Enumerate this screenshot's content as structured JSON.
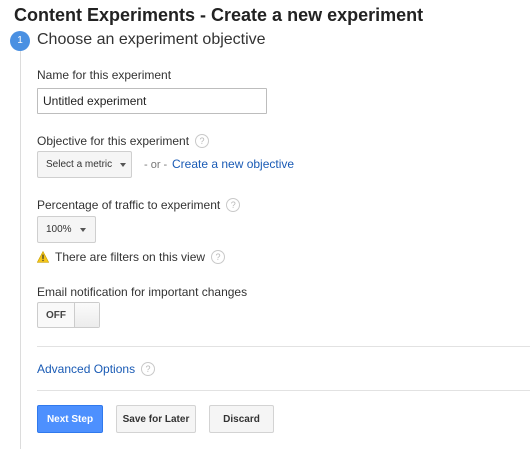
{
  "header": {
    "title": "Content Experiments - Create a new experiment"
  },
  "step": {
    "number": "1",
    "title": "Choose an experiment objective"
  },
  "name_field": {
    "label": "Name for this experiment",
    "value": "Untitled experiment"
  },
  "objective": {
    "label": "Objective for this experiment",
    "select_label": "Select a metric",
    "or_text": "- or -",
    "create_link": "Create a new objective"
  },
  "traffic": {
    "label": "Percentage of traffic to experiment",
    "selected": "100%"
  },
  "filters_warning": {
    "text": "There are filters on this view"
  },
  "email": {
    "label": "Email notification for important changes",
    "toggle_state": "OFF"
  },
  "advanced": {
    "link": "Advanced Options"
  },
  "help_glyph": "?",
  "buttons": {
    "next": "Next Step",
    "save": "Save for Later",
    "discard": "Discard"
  },
  "colors": {
    "accent": "#4a90e2",
    "link": "#1a5bb5",
    "primary_button": "#4d90fe",
    "warning": "#f5c518"
  },
  "icons": {
    "help": "question-circle-icon",
    "warning": "warning-triangle-icon",
    "caret": "caret-down-icon"
  }
}
